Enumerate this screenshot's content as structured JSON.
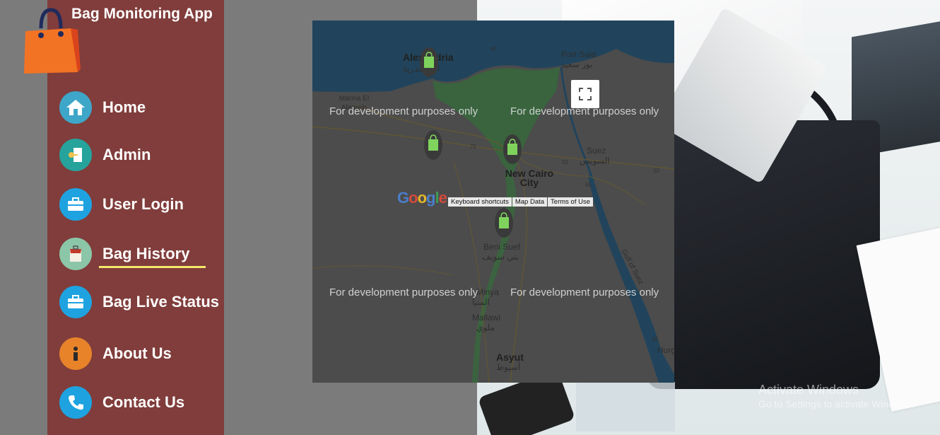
{
  "app": {
    "title": "Bag Monitoring App"
  },
  "nav": {
    "items": [
      {
        "label": "Home",
        "icon": "home-icon"
      },
      {
        "label": "Admin",
        "icon": "key-door-icon"
      },
      {
        "label": "User Login",
        "icon": "briefcase-icon"
      },
      {
        "label": "Bag History",
        "icon": "bag-history-icon",
        "active": true
      },
      {
        "label": "Bag Live Status",
        "icon": "briefcase-icon"
      },
      {
        "label": "About Us",
        "icon": "info-icon"
      },
      {
        "label": "Contact Us",
        "icon": "phone-icon"
      }
    ]
  },
  "map": {
    "dev_notice": "For development purposes only",
    "google_logo": "Google",
    "attribution": {
      "shortcuts": "Keyboard shortcuts",
      "map_data": "Map Data",
      "terms": "Terms of Use"
    },
    "cities": {
      "alexandria_en": "Alexandria",
      "alexandria_ar": "الإسكندرية",
      "port_said_en": "Port Said",
      "port_said_ar": "بور سعيد",
      "marina": "Marina El Alamein",
      "suez_en": "Suez",
      "suez_ar": "السويس",
      "new_cairo": "New Cairo City",
      "new_cairo_ar": "مدينة القاهرة الجديدة",
      "beni_suef_en": "Beni Suef",
      "beni_suef_ar": "بني سويف",
      "minya_en": "Minya",
      "minya_ar": "المنيا",
      "mallawi_en": "Mallawi",
      "mallawi_ar": "ملوي",
      "asyut_en": "Asyut",
      "asyut_ar": "أسيوط",
      "gulf": "Gulf of Suez",
      "hurghada": "Hurg"
    },
    "roads": {
      "r40": "40",
      "r75": "75",
      "r50": "50",
      "r65": "65"
    },
    "colors": {
      "water": "#2f5f80",
      "land": "#6a6a6a",
      "green": "#4e8f55",
      "marker": "#7fd35d"
    }
  },
  "os_overlay": {
    "line1": "Activate Windows",
    "line2": "Go to Settings to activate Windows."
  }
}
